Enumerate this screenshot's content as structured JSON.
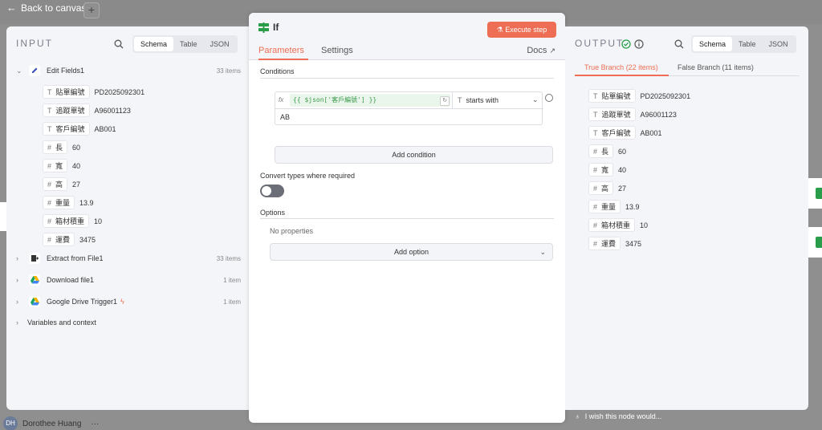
{
  "topbar": {
    "back_label": "Back to canvas",
    "plus": "+"
  },
  "user": {
    "initials": "DH",
    "name": "Dorothee Huang",
    "menu": "···"
  },
  "input": {
    "title": "INPUT",
    "views": [
      "Schema",
      "Table",
      "JSON"
    ],
    "nodes": [
      {
        "name": "Edit Fields1",
        "count": "33 items",
        "expanded": true
      },
      {
        "name": "Extract from File1",
        "count": "33 items"
      },
      {
        "name": "Download file1",
        "count": "1 item"
      },
      {
        "name": "Google Drive Trigger1",
        "count": "1 item"
      }
    ],
    "variables": "Variables and context",
    "fields": [
      {
        "type": "T",
        "key": "貼單編號",
        "value": "PD2025092301"
      },
      {
        "type": "T",
        "key": "追蹤單號",
        "value": "A96001123"
      },
      {
        "type": "T",
        "key": "客戶編號",
        "value": "AB001"
      },
      {
        "type": "#",
        "key": "長",
        "value": "60"
      },
      {
        "type": "#",
        "key": "寬",
        "value": "40"
      },
      {
        "type": "#",
        "key": "高",
        "value": "27"
      },
      {
        "type": "#",
        "key": "重量",
        "value": "13.9"
      },
      {
        "type": "#",
        "key": "箱材積重",
        "value": "10"
      },
      {
        "type": "#",
        "key": "運費",
        "value": "3475"
      }
    ]
  },
  "modal": {
    "title": "If",
    "execute_label": "Execute step",
    "tabs": [
      "Parameters",
      "Settings"
    ],
    "docs_label": "Docs",
    "conditions_label": "Conditions",
    "condition": {
      "fx": "fx",
      "expression": "{{ $json['客戶編號'] }}",
      "operator": "starts with",
      "operator_type": "T",
      "value": "AB"
    },
    "add_condition": "Add condition",
    "convert_label": "Convert types where required",
    "options_label": "Options",
    "no_properties": "No properties",
    "add_option": "Add option"
  },
  "output": {
    "title": "OUTPUT",
    "views": [
      "Schema",
      "Table",
      "JSON"
    ],
    "branches": [
      "True Branch (22 items)",
      "False Branch (11 items)"
    ],
    "fields": [
      {
        "type": "T",
        "key": "貼單編號",
        "value": "PD2025092301"
      },
      {
        "type": "T",
        "key": "追蹤單號",
        "value": "A96001123"
      },
      {
        "type": "T",
        "key": "客戶編號",
        "value": "AB001"
      },
      {
        "type": "#",
        "key": "長",
        "value": "60"
      },
      {
        "type": "#",
        "key": "寬",
        "value": "40"
      },
      {
        "type": "#",
        "key": "高",
        "value": "27"
      },
      {
        "type": "#",
        "key": "重量",
        "value": "13.9"
      },
      {
        "type": "#",
        "key": "箱材積重",
        "value": "10"
      },
      {
        "type": "#",
        "key": "運費",
        "value": "3475"
      }
    ]
  },
  "wish_label": "I wish this node would...",
  "colors": {
    "accent": "#ed6e54",
    "success": "#2a9d4a",
    "expression_green": "#3c9b4b"
  }
}
